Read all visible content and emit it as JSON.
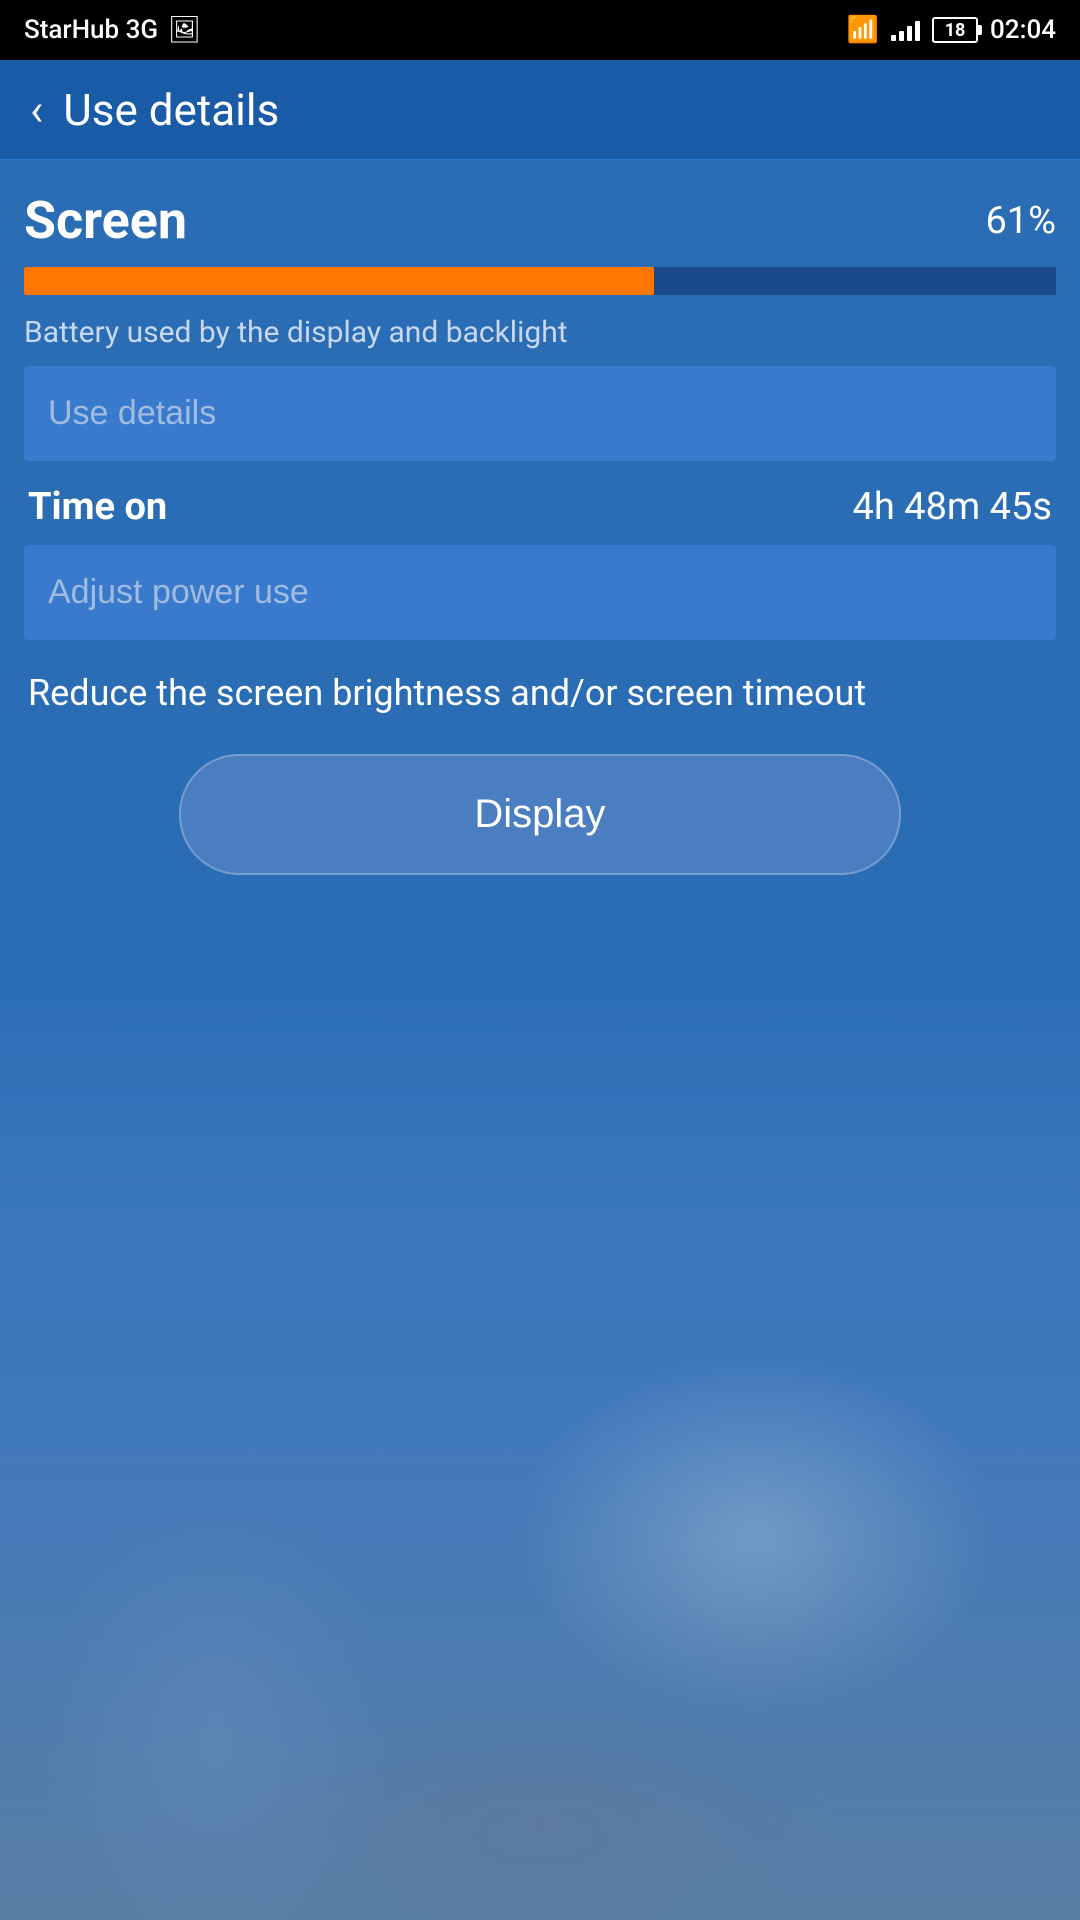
{
  "statusBar": {
    "carrier": "StarHub 3G",
    "time": "02:04",
    "batteryLevel": "18"
  },
  "toolbar": {
    "backLabel": "‹",
    "title": "Use details"
  },
  "main": {
    "sectionTitle": "Screen",
    "percentLabel": "61%",
    "progressPercent": 61,
    "batteryDescription": "Battery used by the display and backlight",
    "useDetailsButton": "Use details",
    "timeOnLabel": "Time on",
    "timeOnValue": "4h 48m 45s",
    "adjustPowerButton": "Adjust power use",
    "reduceDescription": "Reduce the screen brightness and/or screen timeout",
    "displayButton": "Display"
  }
}
